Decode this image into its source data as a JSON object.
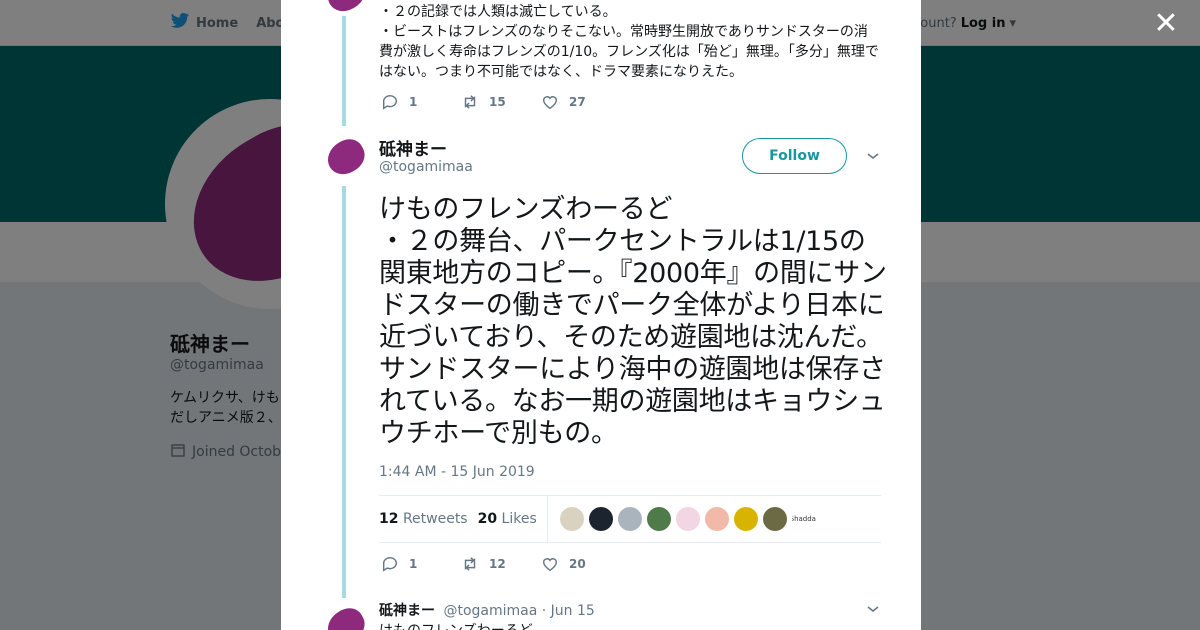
{
  "topbar": {
    "home_label": "Home",
    "about_label": "Abo",
    "account_prompt": "ccount?",
    "login_label": "Log in"
  },
  "profile": {
    "name": "砥神まー",
    "handle": "@togamimaa",
    "bio": "ケムリクサ、けも\nだしアニメ版２、",
    "joined": "Joined Octobe"
  },
  "prev_tweet": {
    "text": "・２の記録では人類は滅亡している。\n・ビーストはフレンズのなりそこない。常時野生開放でありサンドスターの消費が激しく寿命はフレンズの1/10。フレンズ化は「殆ど」無理。「多分」無理ではない。つまり不可能ではなく、ドラマ要素になりえた。",
    "replies": "1",
    "retweets": "15",
    "likes": "27"
  },
  "main_tweet": {
    "name": "砥神まー",
    "handle": "@togamimaa",
    "follow_label": "Follow",
    "text": "けものフレンズわーるど\n・２の舞台、パークセントラルは1/15の関東地方のコピー。『2000年』の間にサンドスターの働きでパーク全体がより日本に近づいており、そのため遊園地は沈んだ。サンドスターにより海中の遊園地は保存されている。なお一期の遊園地はキョウシュウチホーで別もの。",
    "timestamp": "1:44 AM - 15 Jun 2019",
    "retweet_count": "12",
    "retweet_label": "Retweets",
    "like_count": "20",
    "like_label": "Likes",
    "likers": [
      {
        "color": "#d9d2c0",
        "text": ""
      },
      {
        "color": "#1c2430",
        "text": ""
      },
      {
        "color": "#aab4bd",
        "text": ""
      },
      {
        "color": "#4f7a4a",
        "text": ""
      },
      {
        "color": "#f3d6e4",
        "text": ""
      },
      {
        "color": "#f2b8a8",
        "text": ""
      },
      {
        "color": "#d8b400",
        "text": ""
      },
      {
        "color": "#6b6a45",
        "text": ""
      },
      {
        "color": "#ffffff",
        "text": "Shaddai"
      }
    ],
    "replies": "1",
    "retweets": "12",
    "likes": "20"
  },
  "next_tweet": {
    "name": "砥神まー",
    "handle": "@togamimaa",
    "date": "· Jun 15",
    "text": "けものフレンズわーるど"
  },
  "colors": {
    "banner": "#006a6a",
    "accent": "#1b95a0",
    "avatar": "#8e2a7d",
    "thread_line": "#a6d9e0"
  }
}
